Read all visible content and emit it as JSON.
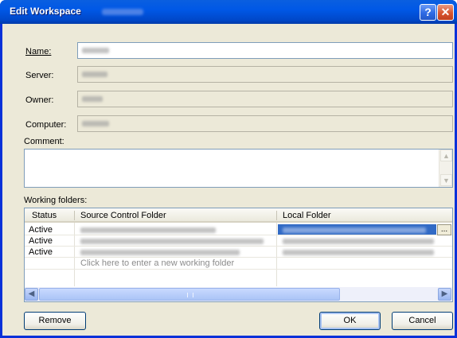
{
  "window": {
    "title": "Edit Workspace",
    "help_glyph": "?",
    "close_glyph": "✕"
  },
  "fields": {
    "name_label": "Name:",
    "name_value": "",
    "server_label": "Server:",
    "server_value": "",
    "owner_label": "Owner:",
    "owner_value": "",
    "computer_label": "Computer:",
    "computer_value": "",
    "comment_label": "Comment:",
    "comment_value": ""
  },
  "working_folders": {
    "label": "Working folders:",
    "columns": [
      "Status",
      "Source Control Folder",
      "Local Folder"
    ],
    "rows": [
      {
        "status": "Active",
        "source": "",
        "local": ""
      },
      {
        "status": "Active",
        "source": "",
        "local": ""
      },
      {
        "status": "Active",
        "source": "",
        "local": ""
      }
    ],
    "new_row_placeholder": "Click here to enter a new working folder",
    "browse_glyph": "..."
  },
  "buttons": {
    "remove": "Remove",
    "ok": "OK",
    "cancel": "Cancel"
  },
  "colors": {
    "titlebar": "#0058e6",
    "dialog_bg": "#ece9d8",
    "selection": "#316ac5"
  }
}
